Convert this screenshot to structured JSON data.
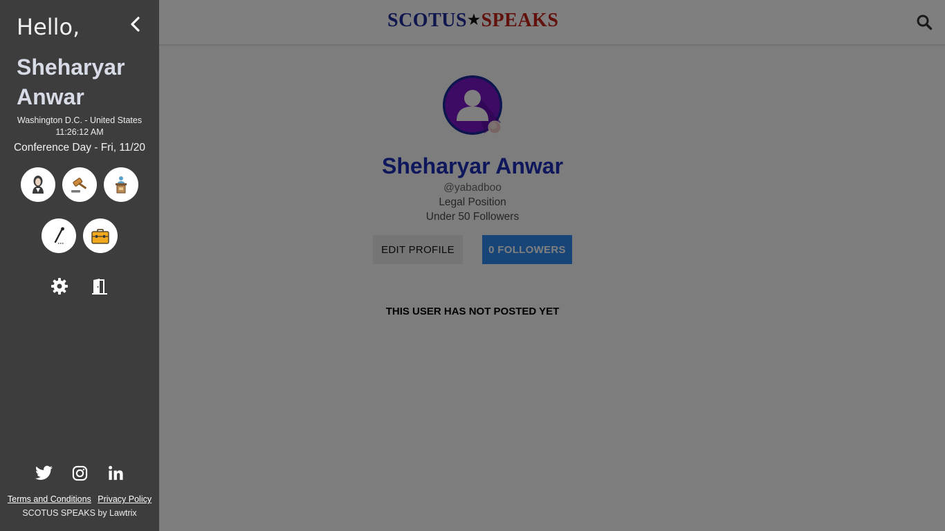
{
  "sidebar": {
    "greeting": "Hello,",
    "user_first": "Sheharyar",
    "user_last": "Anwar",
    "location": "Washington D.C. - United States",
    "time": "11:26:12 AM",
    "conference": "Conference Day - Fri, 11/20",
    "nav_icons": [
      "justice-icon",
      "gavel-icon",
      "podium-icon",
      "pen-icon",
      "briefcase-icon"
    ],
    "utility_icons": [
      "gear-icon",
      "logout-door-icon"
    ],
    "social_icons": [
      "twitter-icon",
      "instagram-icon",
      "linkedin-icon"
    ],
    "links": {
      "terms": "Terms and Conditions",
      "privacy": "Privacy Policy"
    },
    "credit": "SCOTUS SPEAKS by Lawtrix"
  },
  "header": {
    "logo_left": "SCOTUS",
    "logo_star": "★",
    "logo_right": "SPEAKS"
  },
  "profile": {
    "name": "Sheharyar Anwar",
    "handle": "@yabadboo",
    "position": "Legal Position",
    "followers_note": "Under 50 Followers",
    "edit_label": "EDIT PROFILE",
    "followers_label": "0 FOLLOWERS",
    "empty_message": "THIS USER HAS NOT POSTED YET"
  },
  "colors": {
    "sidebar_bg": "#3d3d3d",
    "accent_blue": "#2f8af0",
    "name_blue": "#1d2cb8",
    "logo_blue": "#1f2f9c",
    "logo_red": "#c42418",
    "avatar_purple": "#7a14c8"
  }
}
